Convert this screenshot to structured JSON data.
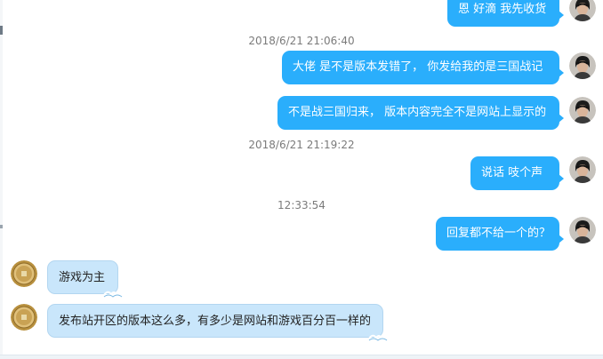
{
  "messages": [
    {
      "side": "out",
      "text": "恩 好滴 我先收货"
    },
    {
      "side": "out",
      "text": "大佬 是不是版本发错了， 你发给我的是三国战记"
    },
    {
      "side": "out",
      "text": "不是战三国归来， 版本内容完全不是网站上显示的"
    },
    {
      "side": "out",
      "text": "说话 吱个声"
    },
    {
      "side": "out",
      "text": "回复都不给一个的？"
    },
    {
      "side": "in",
      "text": "游戏为主"
    },
    {
      "side": "in",
      "text": "发布站开区的版本这么多，有多少是网站和游戏百分百一样的"
    }
  ],
  "timestamps": [
    "2018/6/21 21:06:40",
    "2018/6/21 21:19:22",
    "12:33:54"
  ],
  "colors": {
    "outgoing_bubble": "#2aaefc",
    "incoming_bubble": "#c9e6fb",
    "timestamp": "#7b7b7b"
  },
  "icons": {
    "self_avatar": "person-photo-avatar",
    "peer_avatar": "gold-coin-avatar"
  }
}
